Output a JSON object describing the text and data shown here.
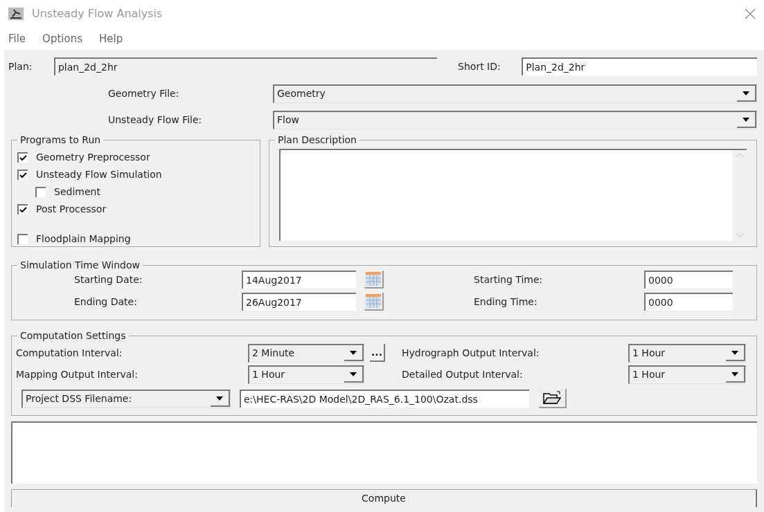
{
  "window": {
    "title": "Unsteady Flow Analysis"
  },
  "menu": [
    "File",
    "Options",
    "Help"
  ],
  "plan": {
    "label": "Plan:",
    "value": "plan_2d_2hr"
  },
  "short_id": {
    "label": "Short ID:",
    "value": "Plan_2d_2hr"
  },
  "geometry_file": {
    "label": "Geometry File:",
    "value": "Geometry"
  },
  "unsteady_flow_file": {
    "label": "Unsteady Flow File:",
    "value": "Flow"
  },
  "programs_to_run": {
    "title": "Programs to Run",
    "items": [
      {
        "label": "Geometry Preprocessor",
        "checked": true
      },
      {
        "label": "Unsteady Flow Simulation",
        "checked": true,
        "children": [
          {
            "label": "Sediment",
            "checked": false
          }
        ]
      },
      {
        "label": "Post Processor",
        "checked": true
      },
      {
        "label": "Floodplain Mapping",
        "checked": false
      }
    ]
  },
  "plan_description": {
    "title": "Plan Description"
  },
  "simulation_time_window": {
    "title": "Simulation Time Window",
    "starting_date": {
      "label": "Starting Date:",
      "value": "14Aug2017"
    },
    "ending_date": {
      "label": "Ending Date:",
      "value": "26Aug2017"
    },
    "starting_time": {
      "label": "Starting Time:",
      "value": "0000"
    },
    "ending_time": {
      "label": "Ending Time:",
      "value": "0000"
    }
  },
  "computation_settings": {
    "title": "Computation Settings",
    "computation_interval": {
      "label": "Computation Interval:",
      "value": "2 Minute"
    },
    "more_button": "...",
    "hydrograph_output_interval": {
      "label": "Hydrograph Output Interval:",
      "value": "1 Hour"
    },
    "mapping_output_interval": {
      "label": "Mapping Output Interval:",
      "value": "1 Hour"
    },
    "detailed_output_interval": {
      "label": "Detailed Output Interval:",
      "value": "1 Hour"
    },
    "dss_selector": "Project DSS Filename:",
    "dss_path": "e:\\HEC-RAS\\2D Model\\2D_RAS_6.1_100\\Ozat.dss"
  },
  "compute_button": "Compute"
}
